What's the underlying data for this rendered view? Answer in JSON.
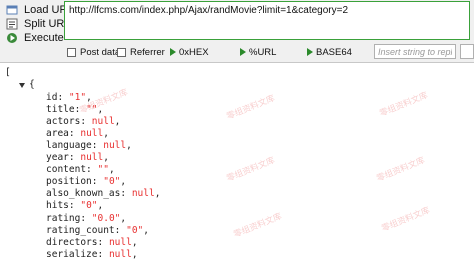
{
  "toolbar": {
    "load_url": "Load URL",
    "split_url": "Split URL",
    "execute": "Execute",
    "url": "http://lfcms.com/index.php/Ajax/randMovie?limit=1&category=2",
    "post_data": "Post data",
    "referrer": "Referrer",
    "hex": "0xHEX",
    "urlenc": "%URL",
    "base64": "BASE64",
    "replace_placeholder": "Insert string to replace",
    "icons": {
      "load_url": "load-url-icon",
      "split_url": "split-url-icon",
      "execute": "execute-icon"
    }
  },
  "json_view": {
    "open_bracket": "[",
    "open_brace": "{",
    "fields": [
      {
        "key": "id",
        "value": "\"1\"",
        "type": "string"
      },
      {
        "key": "title",
        "value": "\"\"",
        "type": "string"
      },
      {
        "key": "actors",
        "value": "null",
        "type": "null"
      },
      {
        "key": "area",
        "value": "null",
        "type": "null"
      },
      {
        "key": "language",
        "value": "null",
        "type": "null"
      },
      {
        "key": "year",
        "value": "null",
        "type": "null"
      },
      {
        "key": "content",
        "value": "\"\"",
        "type": "string"
      },
      {
        "key": "position",
        "value": "\"0\"",
        "type": "string"
      },
      {
        "key": "also_known_as",
        "value": "null",
        "type": "null"
      },
      {
        "key": "hits",
        "value": "\"0\"",
        "type": "string"
      },
      {
        "key": "rating",
        "value": "\"0.0\"",
        "type": "string"
      },
      {
        "key": "rating_count",
        "value": "\"0\"",
        "type": "string"
      },
      {
        "key": "directors",
        "value": "null",
        "type": "null"
      },
      {
        "key": "serialize",
        "value": "null",
        "type": "null"
      }
    ]
  },
  "watermark": "零组资料文库",
  "colors": {
    "url_border": "#3aa13a",
    "value_red": "#e83030",
    "arrow_green": "#2b8a2b"
  }
}
